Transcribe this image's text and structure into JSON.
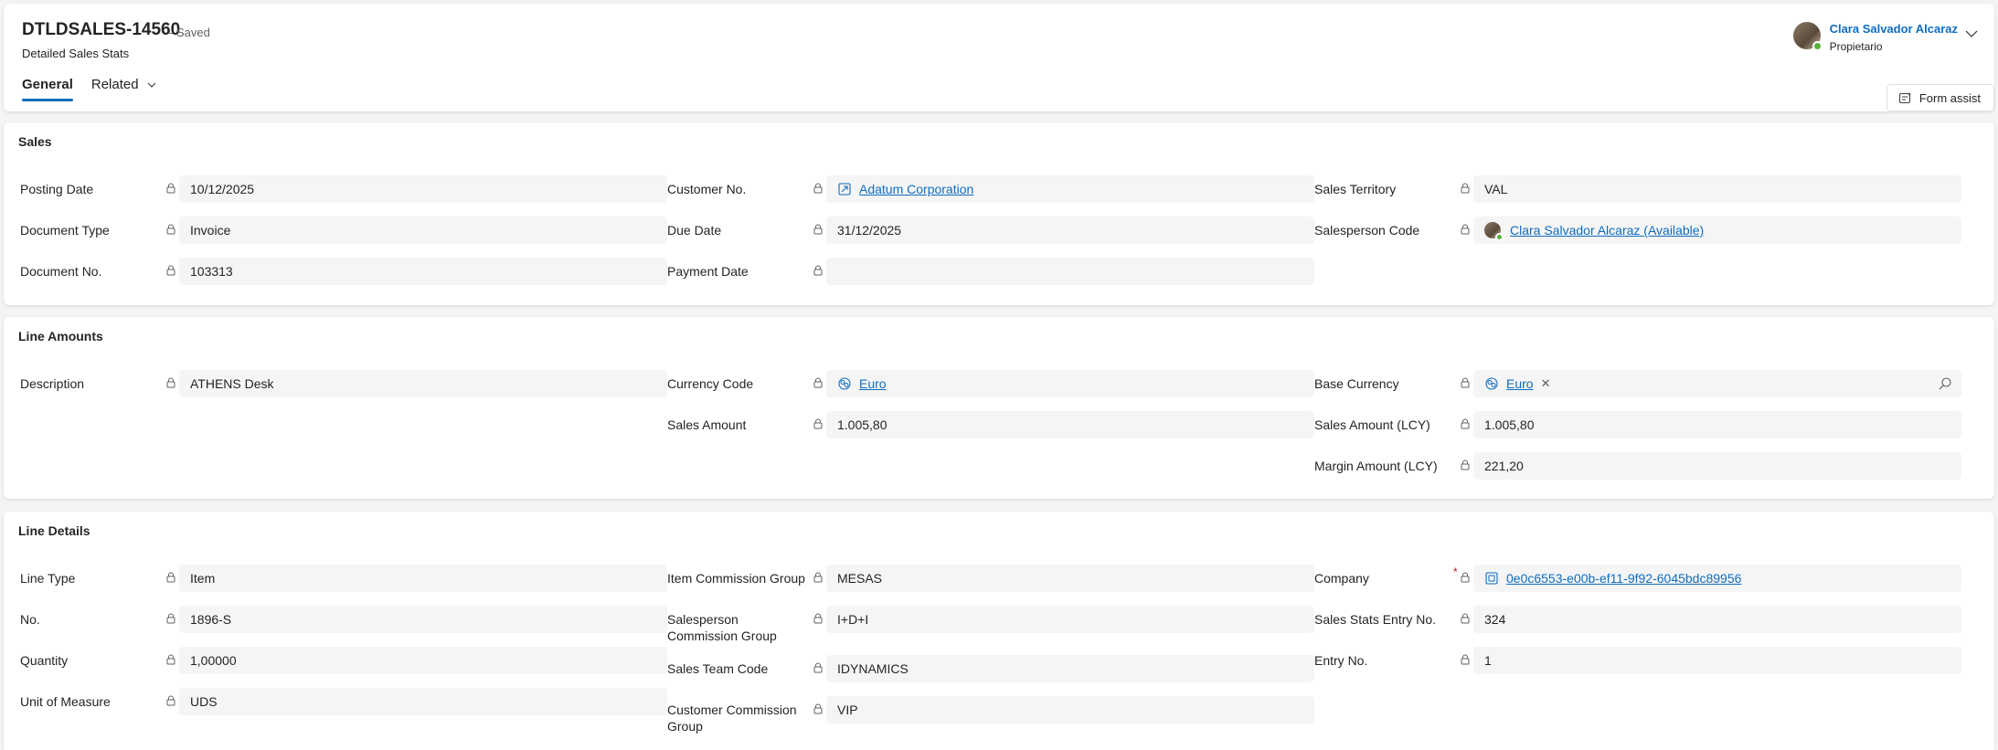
{
  "header": {
    "record_title": "DTLDSALES-14560",
    "saved_status": "- Saved",
    "entity_name": "Detailed Sales Stats",
    "tabs": [
      {
        "label": "General"
      },
      {
        "label": "Related"
      }
    ],
    "owner": {
      "name": "Clara Salvador Alcaraz",
      "role": "Propietario"
    },
    "form_assist": "Form assist"
  },
  "sections": {
    "sales": {
      "title": "Sales",
      "posting_date": {
        "label": "Posting Date",
        "value": "10/12/2025"
      },
      "document_type": {
        "label": "Document Type",
        "value": "Invoice"
      },
      "document_no": {
        "label": "Document No.",
        "value": "103313"
      },
      "customer_no": {
        "label": "Customer No.",
        "value": "Adatum Corporation"
      },
      "due_date": {
        "label": "Due Date",
        "value": "31/12/2025"
      },
      "payment_date": {
        "label": "Payment Date",
        "value": ""
      },
      "sales_territory": {
        "label": "Sales Territory",
        "value": "VAL"
      },
      "salesperson_code": {
        "label": "Salesperson Code",
        "value": "Clara Salvador Alcaraz (Available)"
      }
    },
    "line_amounts": {
      "title": "Line Amounts",
      "description": {
        "label": "Description",
        "value": "ATHENS Desk"
      },
      "currency_code": {
        "label": "Currency Code",
        "value": "Euro"
      },
      "sales_amount": {
        "label": "Sales Amount",
        "value": "1.005,80"
      },
      "base_currency": {
        "label": "Base Currency",
        "value": "Euro"
      },
      "sales_amount_lcy": {
        "label": "Sales Amount (LCY)",
        "value": "1.005,80"
      },
      "margin_amount_lcy": {
        "label": "Margin Amount (LCY)",
        "value": "221,20"
      }
    },
    "line_details": {
      "title": "Line Details",
      "line_type": {
        "label": "Line Type",
        "value": "Item"
      },
      "no": {
        "label": "No.",
        "value": "1896-S"
      },
      "quantity": {
        "label": "Quantity",
        "value": "1,00000"
      },
      "unit_of_measure": {
        "label": "Unit of Measure",
        "value": "UDS"
      },
      "item_commission_group": {
        "label": "Item Commission Group",
        "value": "MESAS"
      },
      "salesperson_commission_group": {
        "label": "Salesperson Commission Group",
        "value": "I+D+I"
      },
      "sales_team_code": {
        "label": "Sales Team Code",
        "value": "IDYNAMICS"
      },
      "customer_commission_group": {
        "label": "Customer Commission Group",
        "value": "VIP"
      },
      "company": {
        "label": "Company",
        "value": "0e0c6553-e00b-ef11-9f92-6045bdc89956",
        "required_mark": "*"
      },
      "sales_stats_entry_no": {
        "label": "Sales Stats Entry No.",
        "value": "324"
      },
      "entry_no": {
        "label": "Entry No.",
        "value": "1"
      }
    }
  },
  "colors": {
    "accent": "#0f6cbd",
    "presence": "#5bb03c"
  }
}
